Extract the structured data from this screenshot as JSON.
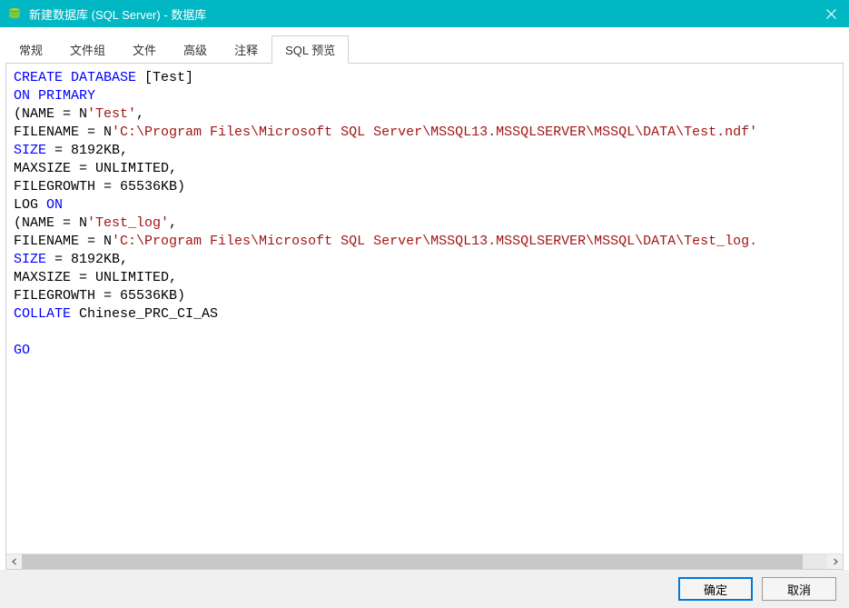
{
  "titlebar": {
    "title": "新建数据库 (SQL Server) - 数据库"
  },
  "tabs": [
    {
      "label": "常规",
      "active": false
    },
    {
      "label": "文件组",
      "active": false
    },
    {
      "label": "文件",
      "active": false
    },
    {
      "label": "高级",
      "active": false
    },
    {
      "label": "注释",
      "active": false
    },
    {
      "label": "SQL 预览",
      "active": true
    }
  ],
  "sql": {
    "tokens": [
      {
        "text": "CREATE",
        "cls": "kw"
      },
      {
        "text": " "
      },
      {
        "text": "DATABASE",
        "cls": "kw"
      },
      {
        "text": " [Test]\n"
      },
      {
        "text": "ON",
        "cls": "kw"
      },
      {
        "text": " "
      },
      {
        "text": "PRIMARY",
        "cls": "kw"
      },
      {
        "text": "\n"
      },
      {
        "text": "(NAME = N"
      },
      {
        "text": "'Test'",
        "cls": "str"
      },
      {
        "text": ",\n"
      },
      {
        "text": "FILENAME = N"
      },
      {
        "text": "'C:\\Program Files\\Microsoft SQL Server\\MSSQL13.MSSQLSERVER\\MSSQL\\DATA\\Test.ndf'",
        "cls": "str"
      },
      {
        "text": "\n"
      },
      {
        "text": "SIZE",
        "cls": "kw"
      },
      {
        "text": " = 8192KB,\n"
      },
      {
        "text": "MAXSIZE = UNLIMITED,\n"
      },
      {
        "text": "FILEGROWTH = 65536KB)\n"
      },
      {
        "text": "LOG "
      },
      {
        "text": "ON",
        "cls": "kw"
      },
      {
        "text": "\n"
      },
      {
        "text": "(NAME = N"
      },
      {
        "text": "'Test_log'",
        "cls": "str"
      },
      {
        "text": ",\n"
      },
      {
        "text": "FILENAME = N"
      },
      {
        "text": "'C:\\Program Files\\Microsoft SQL Server\\MSSQL13.MSSQLSERVER\\MSSQL\\DATA\\Test_log.",
        "cls": "str"
      },
      {
        "text": "\n"
      },
      {
        "text": "SIZE",
        "cls": "kw"
      },
      {
        "text": " = 8192KB,\n"
      },
      {
        "text": "MAXSIZE = UNLIMITED,\n"
      },
      {
        "text": "FILEGROWTH = 65536KB)\n"
      },
      {
        "text": "COLLATE",
        "cls": "kw"
      },
      {
        "text": " Chinese_PRC_CI_AS\n"
      },
      {
        "text": "\n"
      },
      {
        "text": "GO",
        "cls": "kw"
      }
    ]
  },
  "buttons": {
    "ok": "确定",
    "cancel": "取消"
  }
}
